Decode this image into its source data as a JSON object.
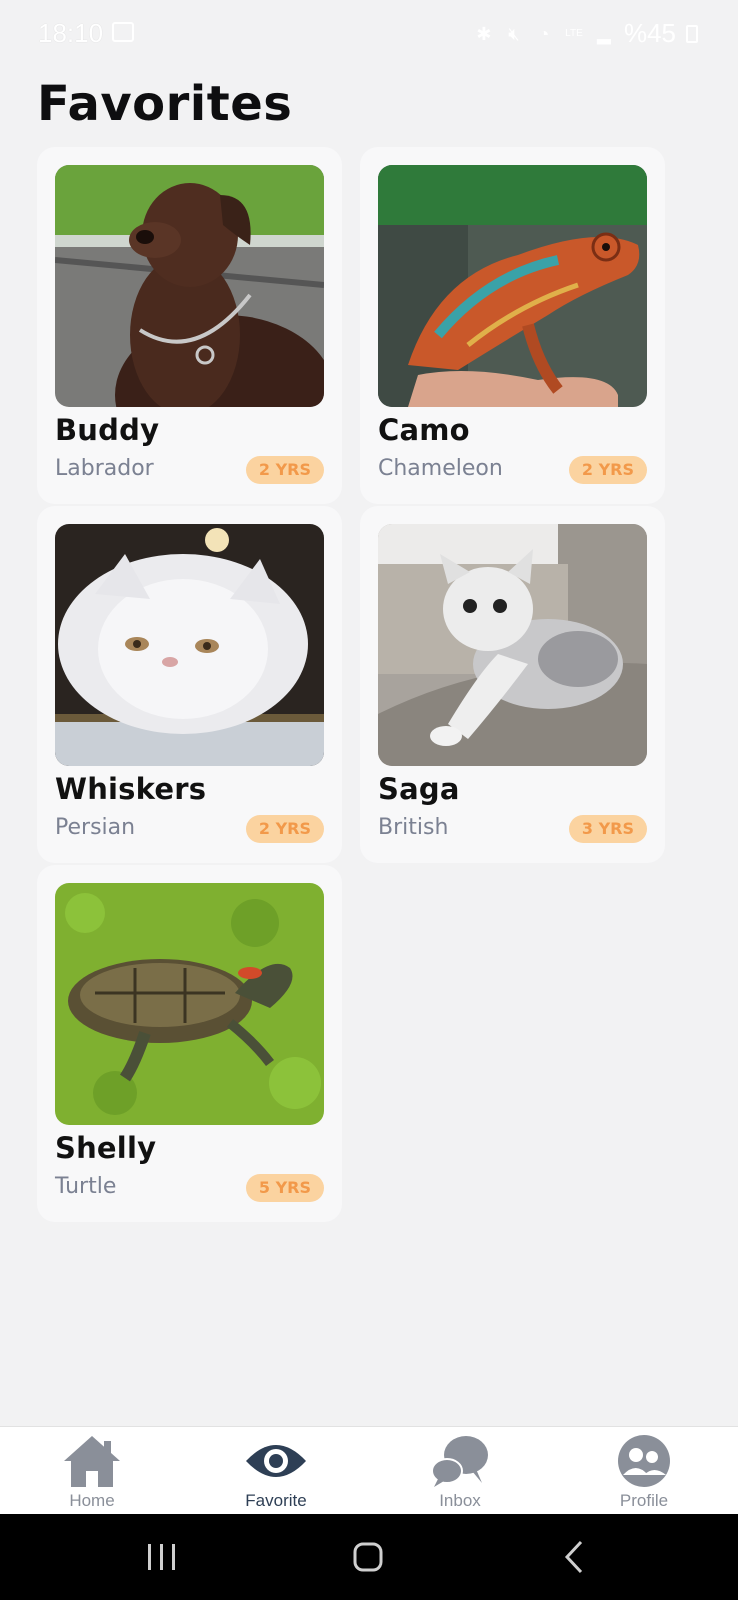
{
  "status_bar": {
    "time": "18:10",
    "battery": "%45",
    "icons": [
      "gallery-icon",
      "bluetooth-icon",
      "mute-icon",
      "wifi-icon",
      "volte-icon",
      "signal-icon",
      "battery-icon"
    ]
  },
  "page": {
    "title": "Favorites"
  },
  "favorites": [
    {
      "name": "Buddy",
      "breed": "Labrador",
      "age": "2 YRS",
      "photo": "chocolate-labrador-photo"
    },
    {
      "name": "Camo",
      "breed": "Chameleon",
      "age": "2 YRS",
      "photo": "chameleon-photo"
    },
    {
      "name": "Whiskers",
      "breed": "Persian",
      "age": "2 YRS",
      "photo": "white-persian-cat-photo"
    },
    {
      "name": "Saga",
      "breed": "British",
      "age": "3 YRS",
      "photo": "british-cat-photo"
    },
    {
      "name": "Shelly",
      "breed": "Turtle",
      "age": "5 YRS",
      "photo": "turtle-photo"
    }
  ],
  "bottom_nav": {
    "active": "Favorite",
    "items": [
      {
        "label": "Home",
        "icon": "home-icon"
      },
      {
        "label": "Favorite",
        "icon": "eye-icon"
      },
      {
        "label": "Inbox",
        "icon": "chat-bubbles-icon"
      },
      {
        "label": "Profile",
        "icon": "users-icon"
      }
    ]
  },
  "colors": {
    "background": "#f2f2f3",
    "card": "#f8f8f9",
    "age_badge_bg": "#fbd3a0",
    "age_badge_text": "#f2994a",
    "nav_active": "#2e3f55",
    "nav_inactive": "#8a8f99"
  }
}
